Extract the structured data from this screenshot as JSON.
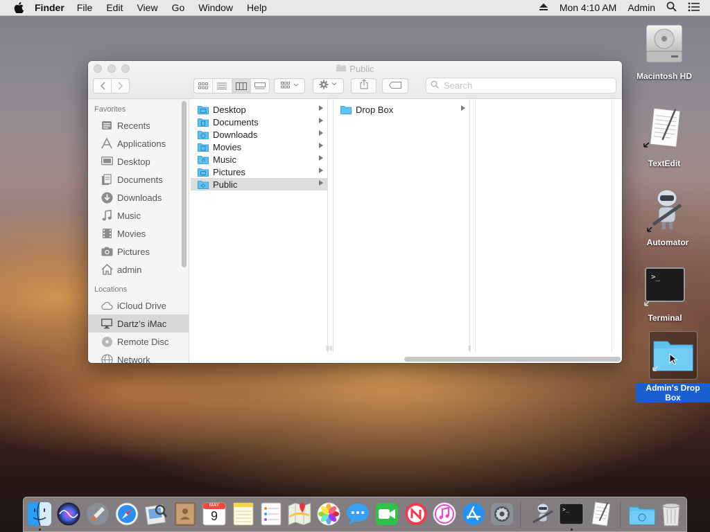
{
  "menubar": {
    "app_name": "Finder",
    "menus": [
      "File",
      "Edit",
      "View",
      "Go",
      "Window",
      "Help"
    ],
    "clock": "Mon 4:10 AM",
    "user": "Admin"
  },
  "window": {
    "title": "Public",
    "search_placeholder": "Search",
    "sidebar": {
      "favorites_header": "Favorites",
      "favorites": [
        {
          "label": "Recents",
          "icon": "recents-icon"
        },
        {
          "label": "Applications",
          "icon": "applications-icon"
        },
        {
          "label": "Desktop",
          "icon": "desktop-icon"
        },
        {
          "label": "Documents",
          "icon": "documents-icon"
        },
        {
          "label": "Downloads",
          "icon": "downloads-icon"
        },
        {
          "label": "Music",
          "icon": "music-icon"
        },
        {
          "label": "Movies",
          "icon": "movies-icon"
        },
        {
          "label": "Pictures",
          "icon": "pictures-icon"
        },
        {
          "label": "admin",
          "icon": "home-icon"
        }
      ],
      "locations_header": "Locations",
      "locations": [
        {
          "label": "iCloud Drive",
          "icon": "cloud-icon"
        },
        {
          "label": "Dartz’s iMac",
          "icon": "imac-icon",
          "selected": true
        },
        {
          "label": "Remote Disc",
          "icon": "disc-icon"
        },
        {
          "label": "Network",
          "icon": "network-icon"
        }
      ]
    },
    "column1": [
      {
        "label": "Desktop"
      },
      {
        "label": "Documents"
      },
      {
        "label": "Downloads"
      },
      {
        "label": "Movies"
      },
      {
        "label": "Music"
      },
      {
        "label": "Pictures"
      },
      {
        "label": "Public",
        "selected": true
      }
    ],
    "column2": [
      {
        "label": "Drop Box"
      }
    ]
  },
  "desktop_icons": [
    {
      "label": "Macintosh HD",
      "icon": "hard-drive-icon"
    },
    {
      "label": "TextEdit",
      "icon": "textedit-icon"
    },
    {
      "label": "Automator",
      "icon": "automator-icon"
    },
    {
      "label": "Terminal",
      "icon": "terminal-icon"
    },
    {
      "label": "Admin's Drop Box",
      "icon": "folder-icon",
      "selected": true
    }
  ],
  "dock": [
    "finder-icon",
    "siri-icon",
    "launchpad-icon",
    "safari-icon",
    "preview-icon",
    "contacts-icon",
    "calendar-icon",
    "notes-icon",
    "reminders-icon",
    "maps-icon",
    "photos-icon",
    "messages-icon",
    "facetime-icon",
    "news-icon",
    "itunes-icon",
    "app-store-icon",
    "system-preferences-icon",
    "automator-icon",
    "terminal-icon",
    "textedit-icon",
    "downloads-folder-icon",
    "trash-icon"
  ],
  "calendar_month": "MAY",
  "calendar_day": "9",
  "colors": {
    "selection_blue": "#1a5fd0",
    "folder_blue": "#5ec2f2"
  }
}
